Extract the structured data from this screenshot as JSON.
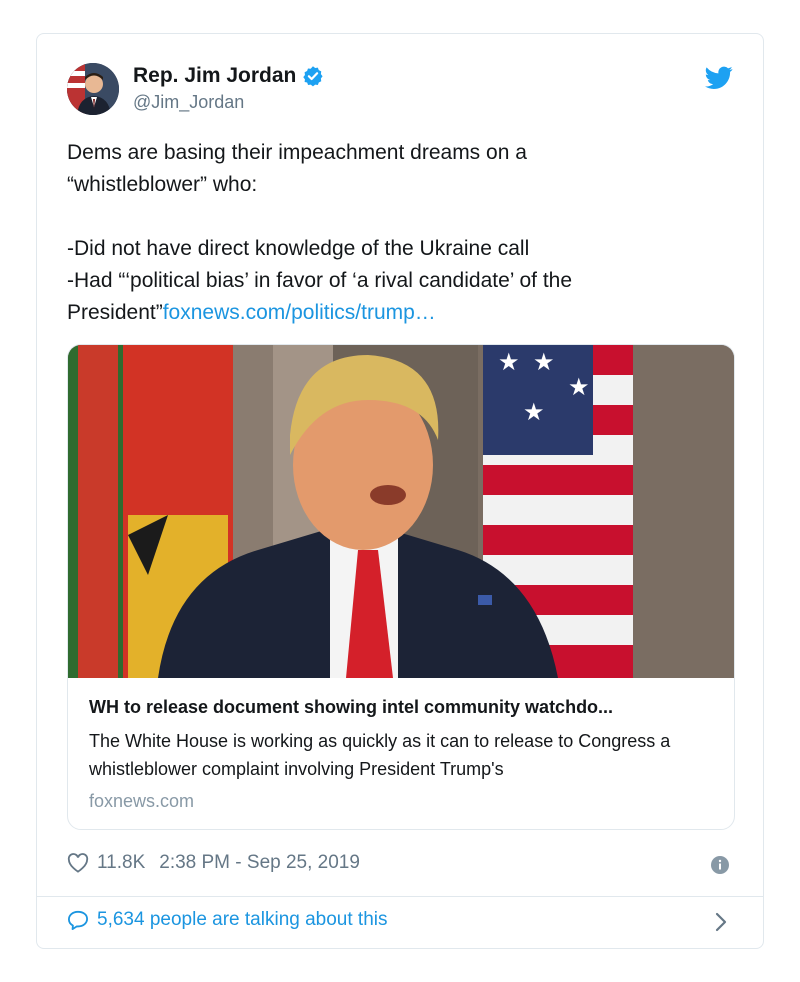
{
  "author": {
    "display_name": "Rep. Jim Jordan",
    "handle": "@Jim_Jordan",
    "verified_icon": "verified-badge-icon",
    "avatar": "author-avatar"
  },
  "platform_icon": "twitter-bird-icon",
  "tweet": {
    "text": "Dems are basing their impeachment dreams on a\n“whistleblower” who:\n\n-Did not have direct knowledge of the Ukraine call\n-Had “‘political bias’ in favor of ‘a rival candidate’ of the\nPresident”",
    "link_text": "foxnews.com/politics/trump…"
  },
  "link_card": {
    "title": "WH to release document showing intel community watchdo...",
    "description": "The White House is working as quickly as it can to release to Congress a whistleblower complaint involving President Trump's",
    "domain": "foxnews.com"
  },
  "meta": {
    "like_count": "11.8K",
    "timestamp": "2:38 PM - Sep 25, 2019",
    "like_icon": "heart-icon",
    "info_icon": "info-icon"
  },
  "footer": {
    "talking_text": "5,634 people are talking about this",
    "talk_icon": "speech-bubble-icon",
    "chevron_icon": "chevron-right-icon"
  },
  "colors": {
    "link_blue": "#1b95e0",
    "muted_gray": "#657786",
    "border": "#e1e8ed"
  }
}
